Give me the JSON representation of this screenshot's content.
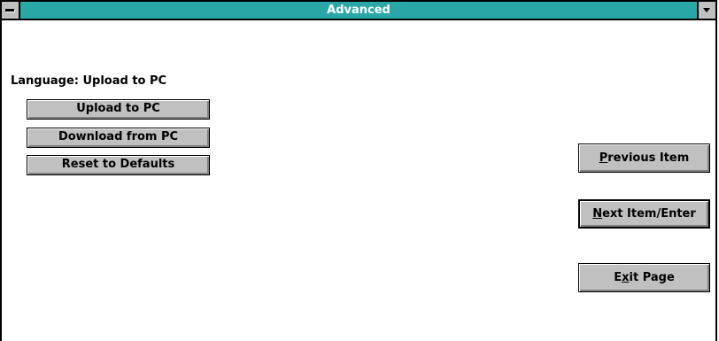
{
  "window": {
    "title": "Advanced"
  },
  "language": {
    "label": "Language: Upload to PC"
  },
  "left_buttons": [
    {
      "label": "Upload to PC"
    },
    {
      "label": "Download from PC"
    },
    {
      "label": "Reset to Defaults"
    }
  ],
  "right_buttons": {
    "previous": {
      "mnemonic": "P",
      "rest": "revious Item"
    },
    "next": {
      "mnemonic": "N",
      "rest": "ext Item/Enter"
    },
    "exit": {
      "pre": "E",
      "mnemonic": "x",
      "rest": "it Page"
    }
  },
  "icons": {
    "system_menu": "system-menu-icon",
    "minimize": "minimize-icon"
  }
}
